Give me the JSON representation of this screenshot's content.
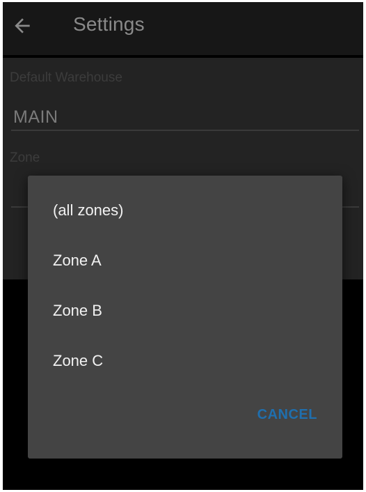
{
  "appbar": {
    "title": "Settings",
    "back_icon": "arrow-left-icon"
  },
  "settings": {
    "warehouse_label": "Default Warehouse",
    "warehouse_value": "MAIN",
    "zone_label": "Zone",
    "zone_value": ""
  },
  "dialog": {
    "options": [
      {
        "label": "(all zones)"
      },
      {
        "label": "Zone A"
      },
      {
        "label": "Zone B"
      },
      {
        "label": "Zone C"
      }
    ],
    "cancel_label": "CANCEL"
  },
  "colors": {
    "background": "#000000",
    "appbar": "#171717",
    "dialog": "#444444",
    "accent": "#1f6fae",
    "option_text": "#f2f2f2"
  }
}
